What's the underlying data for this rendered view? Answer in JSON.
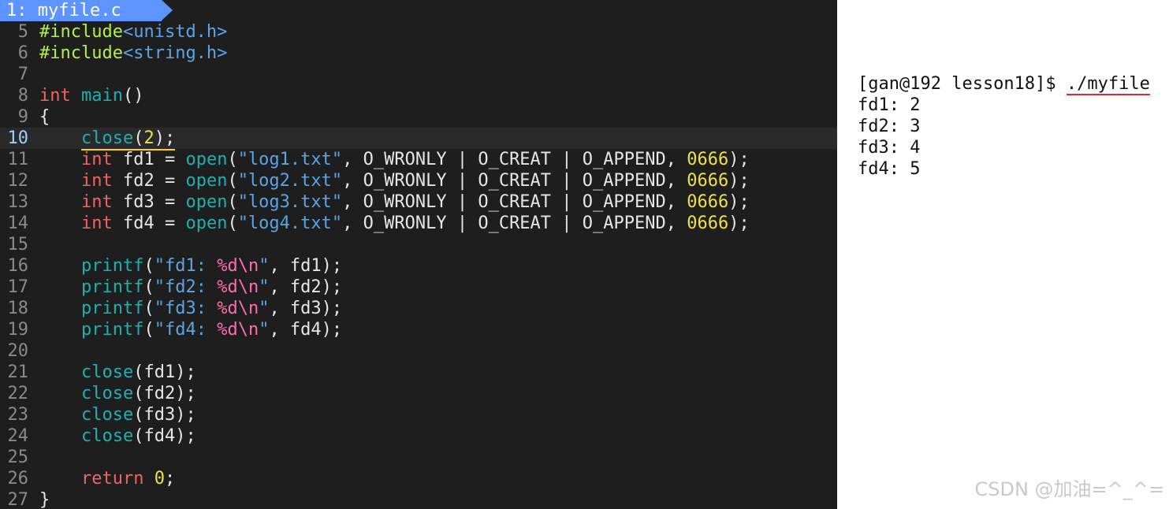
{
  "editor": {
    "tab": {
      "label": "1: myfile.c",
      "accent": "#5e94ff"
    },
    "current_line": "10",
    "lines": [
      {
        "n": "5",
        "s": [
          {
            "t": "#include",
            "c": "k-preproc"
          },
          {
            "t": "<unistd.h>",
            "c": "k-header"
          }
        ]
      },
      {
        "n": "6",
        "s": [
          {
            "t": "#include",
            "c": "k-preproc"
          },
          {
            "t": "<string.h>",
            "c": "k-header"
          }
        ]
      },
      {
        "n": "7",
        "s": []
      },
      {
        "n": "8",
        "s": [
          {
            "t": "int",
            "c": "k-type"
          },
          {
            "t": " "
          },
          {
            "t": "main",
            "c": "k-func"
          },
          {
            "t": "()"
          }
        ]
      },
      {
        "n": "9",
        "s": [
          {
            "t": "{"
          }
        ]
      },
      {
        "n": "10",
        "current": true,
        "s": [
          {
            "t": "    "
          },
          {
            "t": "close",
            "c": "k-func yl-underline"
          },
          {
            "t": "(",
            "c": "yl-underline"
          },
          {
            "t": "2",
            "c": "k-num yl-underline"
          },
          {
            "t": ");",
            "c": "yl-underline"
          }
        ]
      },
      {
        "n": "11",
        "s": [
          {
            "t": "    "
          },
          {
            "t": "int",
            "c": "k-type"
          },
          {
            "t": " fd1 = "
          },
          {
            "t": "open",
            "c": "k-func"
          },
          {
            "t": "("
          },
          {
            "t": "\"log1.txt\"",
            "c": "k-str"
          },
          {
            "t": ", O_WRONLY | O_CREAT | O_APPEND, "
          },
          {
            "t": "0666",
            "c": "k-num"
          },
          {
            "t": ");"
          }
        ]
      },
      {
        "n": "12",
        "s": [
          {
            "t": "    "
          },
          {
            "t": "int",
            "c": "k-type"
          },
          {
            "t": " fd2 = "
          },
          {
            "t": "open",
            "c": "k-func"
          },
          {
            "t": "("
          },
          {
            "t": "\"log2.txt\"",
            "c": "k-str"
          },
          {
            "t": ", O_WRONLY | O_CREAT | O_APPEND, "
          },
          {
            "t": "0666",
            "c": "k-num"
          },
          {
            "t": ");"
          }
        ]
      },
      {
        "n": "13",
        "s": [
          {
            "t": "    "
          },
          {
            "t": "int",
            "c": "k-type"
          },
          {
            "t": " fd3 = "
          },
          {
            "t": "open",
            "c": "k-func"
          },
          {
            "t": "("
          },
          {
            "t": "\"log3.txt\"",
            "c": "k-str"
          },
          {
            "t": ", O_WRONLY | O_CREAT | O_APPEND, "
          },
          {
            "t": "0666",
            "c": "k-num"
          },
          {
            "t": ");"
          }
        ]
      },
      {
        "n": "14",
        "s": [
          {
            "t": "    "
          },
          {
            "t": "int",
            "c": "k-type"
          },
          {
            "t": " fd4 = "
          },
          {
            "t": "open",
            "c": "k-func"
          },
          {
            "t": "("
          },
          {
            "t": "\"log4.txt\"",
            "c": "k-str"
          },
          {
            "t": ", O_WRONLY | O_CREAT | O_APPEND, "
          },
          {
            "t": "0666",
            "c": "k-num"
          },
          {
            "t": ");"
          }
        ]
      },
      {
        "n": "15",
        "s": []
      },
      {
        "n": "16",
        "s": [
          {
            "t": "    "
          },
          {
            "t": "printf",
            "c": "k-func"
          },
          {
            "t": "("
          },
          {
            "t": "\"fd1: ",
            "c": "k-str"
          },
          {
            "t": "%d\\n",
            "c": "k-fmt"
          },
          {
            "t": "\"",
            "c": "k-str"
          },
          {
            "t": ", fd1);"
          }
        ]
      },
      {
        "n": "17",
        "s": [
          {
            "t": "    "
          },
          {
            "t": "printf",
            "c": "k-func"
          },
          {
            "t": "("
          },
          {
            "t": "\"fd2: ",
            "c": "k-str"
          },
          {
            "t": "%d\\n",
            "c": "k-fmt"
          },
          {
            "t": "\"",
            "c": "k-str"
          },
          {
            "t": ", fd2);"
          }
        ]
      },
      {
        "n": "18",
        "s": [
          {
            "t": "    "
          },
          {
            "t": "printf",
            "c": "k-func"
          },
          {
            "t": "("
          },
          {
            "t": "\"fd3: ",
            "c": "k-str"
          },
          {
            "t": "%d\\n",
            "c": "k-fmt"
          },
          {
            "t": "\"",
            "c": "k-str"
          },
          {
            "t": ", fd3);"
          }
        ]
      },
      {
        "n": "19",
        "s": [
          {
            "t": "    "
          },
          {
            "t": "printf",
            "c": "k-func"
          },
          {
            "t": "("
          },
          {
            "t": "\"fd4: ",
            "c": "k-str"
          },
          {
            "t": "%d\\n",
            "c": "k-fmt"
          },
          {
            "t": "\"",
            "c": "k-str"
          },
          {
            "t": ", fd4);"
          }
        ]
      },
      {
        "n": "20",
        "s": []
      },
      {
        "n": "21",
        "s": [
          {
            "t": "    "
          },
          {
            "t": "close",
            "c": "k-func"
          },
          {
            "t": "(fd1);"
          }
        ]
      },
      {
        "n": "22",
        "s": [
          {
            "t": "    "
          },
          {
            "t": "close",
            "c": "k-func"
          },
          {
            "t": "(fd2);"
          }
        ]
      },
      {
        "n": "23",
        "s": [
          {
            "t": "    "
          },
          {
            "t": "close",
            "c": "k-func"
          },
          {
            "t": "(fd3);"
          }
        ]
      },
      {
        "n": "24",
        "s": [
          {
            "t": "    "
          },
          {
            "t": "close",
            "c": "k-func"
          },
          {
            "t": "(fd4);"
          }
        ]
      },
      {
        "n": "25",
        "s": []
      },
      {
        "n": "26",
        "s": [
          {
            "t": "    "
          },
          {
            "t": "return",
            "c": "k-ret"
          },
          {
            "t": " "
          },
          {
            "t": "0",
            "c": "k-num"
          },
          {
            "t": ";"
          }
        ]
      },
      {
        "n": "27",
        "s": [
          {
            "t": "}"
          }
        ]
      }
    ]
  },
  "terminal": {
    "prompt": "[gan@192 lesson18]$ ",
    "command": "./myfile",
    "output": [
      "fd1: 2",
      "fd2: 3",
      "fd3: 4",
      "fd4: 5"
    ]
  },
  "watermark": "CSDN @加油=^_^="
}
